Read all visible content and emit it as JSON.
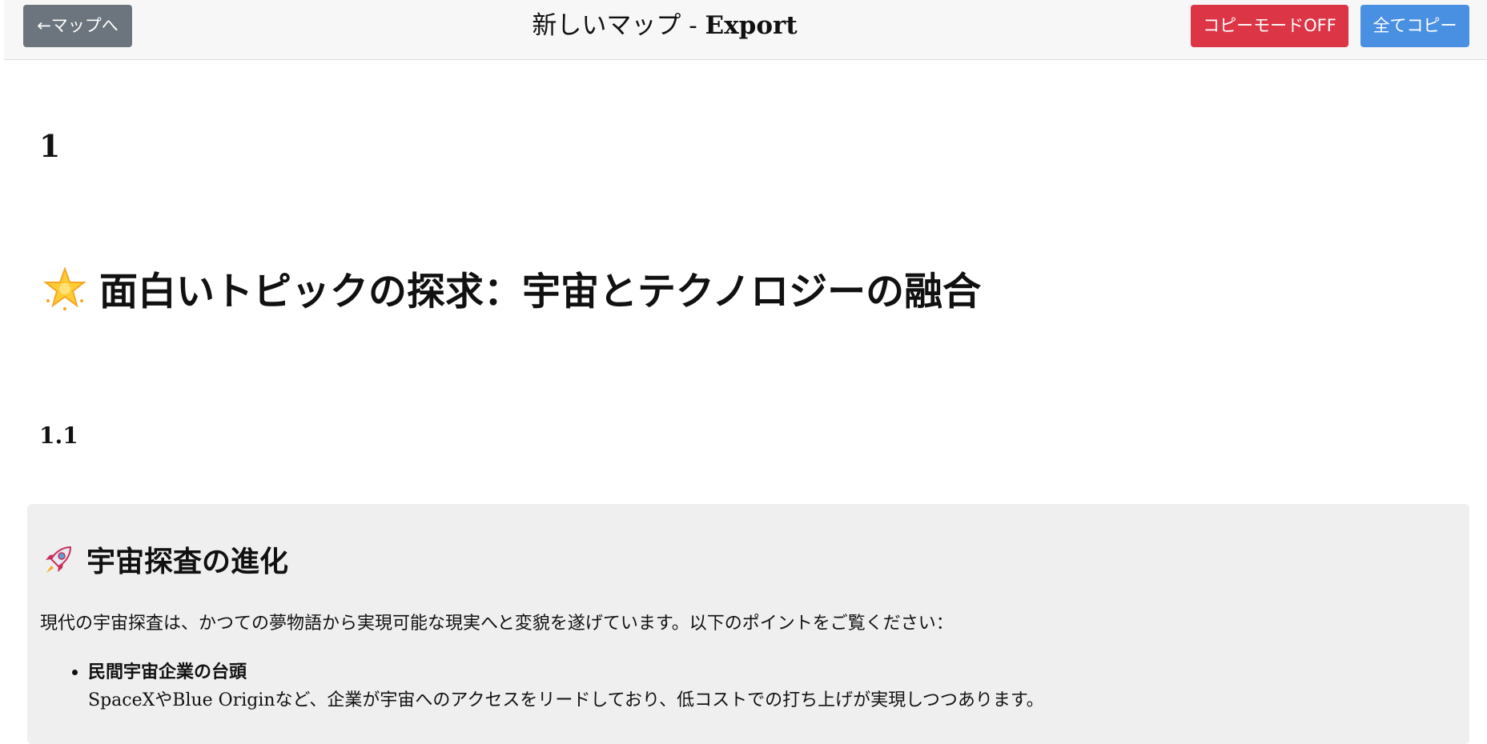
{
  "header": {
    "back_label": "←マップへ",
    "title_prefix": "新しいマップ - ",
    "title_suffix": "Export",
    "copy_mode_label": "コピーモードOFF",
    "copy_all_label": "全てコピー"
  },
  "colors": {
    "back_button": "#6c757d",
    "copy_mode_button": "#dc3545",
    "copy_all_button": "#4a90e2",
    "card_background": "#efefef"
  },
  "content": {
    "heading_1": "1",
    "main_heading": {
      "icon": "glowing-star-icon",
      "text": "面白いトピックの探求：宇宙とテクノロジーの融合"
    },
    "heading_1_1": "1.1",
    "card": {
      "title_icon": "rocket-icon",
      "title": "宇宙探査の進化",
      "intro": "現代の宇宙探査は、かつての夢物語から実現可能な現実へと変貌を遂げています。以下のポイントをご覧ください：",
      "items": [
        {
          "title": "民間宇宙企業の台頭",
          "desc": "SpaceXやBlue Originなど、企業が宇宙へのアクセスをリードしており、低コストでの打ち上げが実現しつつあります。"
        }
      ]
    }
  }
}
